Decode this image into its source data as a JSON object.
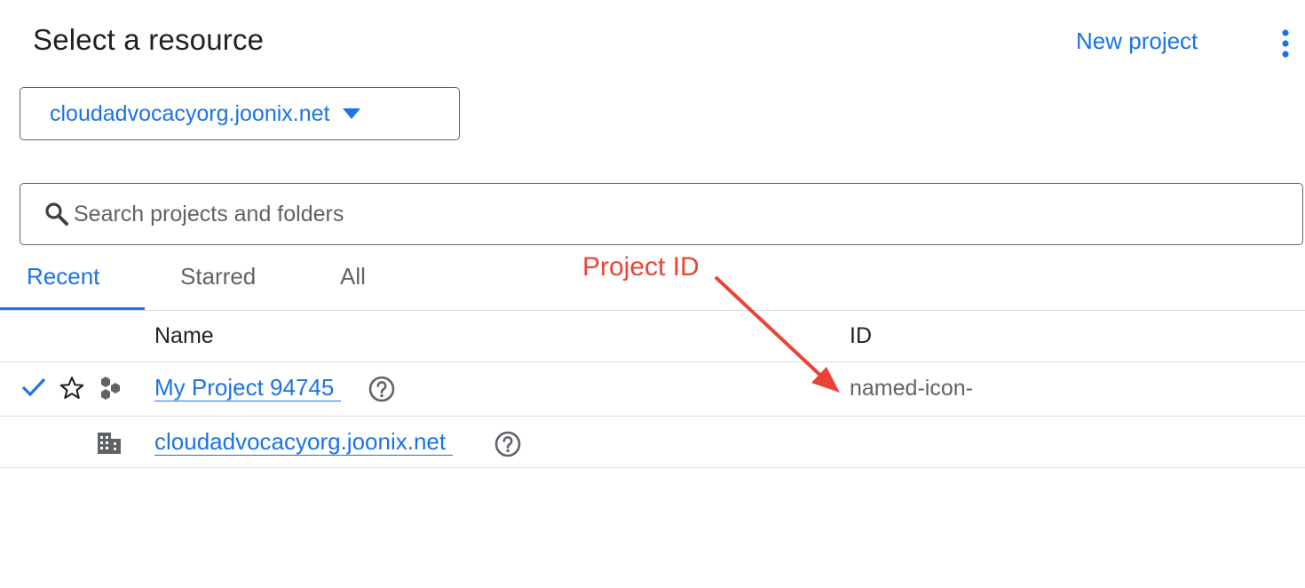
{
  "header": {
    "title": "Select a resource",
    "new_project_label": "New project",
    "more_icon": "more-vert-icon"
  },
  "org_selector": {
    "value": "cloudadvocacyorg.joonix.net",
    "icon": "arrow-drop-down-icon"
  },
  "search": {
    "placeholder": "Search projects and folders",
    "value": "",
    "icon": "search-icon"
  },
  "tabs": [
    {
      "label": "Recent",
      "active": true
    },
    {
      "label": "Starred",
      "active": false
    },
    {
      "label": "All",
      "active": false
    }
  ],
  "table": {
    "columns": [
      "Name",
      "ID"
    ],
    "rows": [
      {
        "selected": true,
        "starred": false,
        "type_icon": "project-hexagons-icon",
        "name": "My Project 94745",
        "id": "named-icon-"
      },
      {
        "selected": false,
        "starred": false,
        "type_icon": "organization-building-icon",
        "name": "cloudadvocacyorg.joonix.net",
        "id": ""
      }
    ]
  },
  "annotation": {
    "label": "Project ID",
    "color": "#ea4335"
  },
  "colors": {
    "accent": "#1a73e8",
    "text": "#202124",
    "muted": "#5f6368",
    "divider": "#dadce0"
  }
}
